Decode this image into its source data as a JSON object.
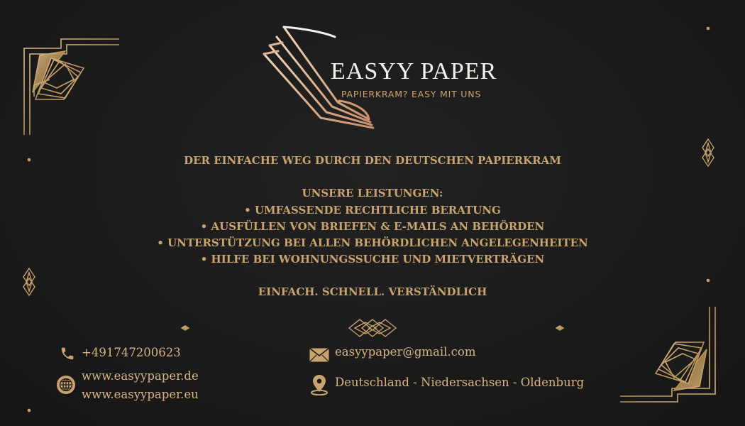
{
  "brand": {
    "name": "EASYY PAPER",
    "tagline": "PAPIERKRAM? EASY MIT UNS"
  },
  "headline": "DER EINFACHE WEG DURCH DEN DEUTSCHEN PAPIERKRAM",
  "services": {
    "title": "UNSERE LEISTUNGEN:",
    "items": [
      "• UMFASSENDE RECHTLICHE BERATUNG",
      "• AUSFÜLLEN VON BRIEFEN & E-MAILS AN BEHÖRDEN",
      "• UNTERSTÜTZUNG BEI ALLEN BEHÖRDLICHEN ANGELEGENHEITEN",
      "• HILFE BEI WOHNUNGSSUCHE UND MIETVERTRÄGEN"
    ]
  },
  "slogan": "EINFACH. SCHNELL. VERSTÄNDLICH",
  "contact": {
    "phone": "+491747200623",
    "websites": [
      "www.easyypaper.de",
      "www.easyypaper.eu"
    ],
    "email": "easyypaper@gmail.com",
    "location": "Deutschland - Niedersachsen - Oldenburg"
  },
  "icons": {
    "phone": "phone-icon",
    "globe": "globe-icon",
    "email": "envelope-icon",
    "location": "map-pin-icon"
  },
  "colors": {
    "background": "#1b1b1b",
    "gold": "#c9a46e",
    "white": "#f4f1ea"
  }
}
